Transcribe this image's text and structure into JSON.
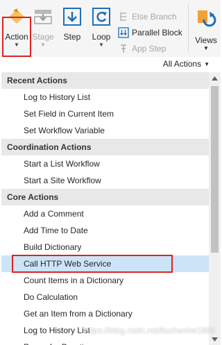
{
  "ribbon": {
    "action_label": "Action",
    "stage_label": "Stage",
    "step_label": "Step",
    "loop_label": "Loop",
    "else_branch_label": "Else Branch",
    "parallel_block_label": "Parallel Block",
    "app_step_label": "App Step",
    "views_label": "Views"
  },
  "filter": {
    "label": "All Actions"
  },
  "groups": {
    "recent": {
      "title": "Recent Actions",
      "items": [
        "Log to History List",
        "Set Field in Current Item",
        "Set Workflow Variable"
      ]
    },
    "coordination": {
      "title": "Coordination Actions",
      "items": [
        "Start a List Workflow",
        "Start a Site Workflow"
      ]
    },
    "core": {
      "title": "Core Actions",
      "items": [
        "Add a Comment",
        "Add Time to Date",
        "Build Dictionary",
        "Call HTTP Web Service",
        "Count Items in a Dictionary",
        "Do Calculation",
        "Get an Item from a Dictionary",
        "Log to History List",
        "Pause for Duration"
      ]
    }
  },
  "selected_item": "Call HTTP Web Service",
  "watermark": "https://blog.csdn.net/liuzhenhe1988",
  "colors": {
    "accent": "#1e6fb8",
    "selected": "#cce4f7",
    "highlight": "#e02020"
  }
}
